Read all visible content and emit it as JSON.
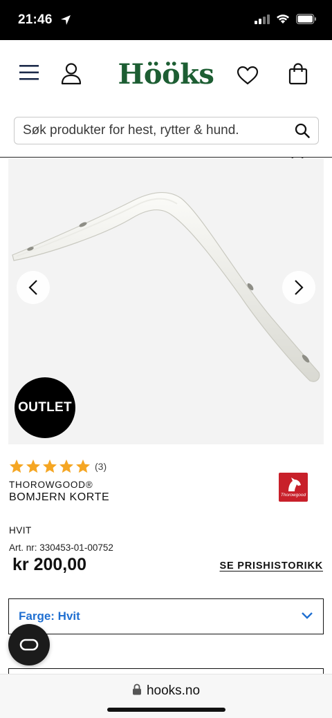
{
  "status_bar": {
    "time": "21:46"
  },
  "header": {
    "logo": "Hööks"
  },
  "search": {
    "placeholder": "Søk produkter for hest, rytter & hund."
  },
  "gallery": {
    "badge": "OUTLET"
  },
  "product": {
    "rating_stars": 5,
    "review_count": "(3)",
    "brand": "THOROWGOOD®",
    "name": "BOMJERN KORTE",
    "brand_logo_text": "Thorowgood",
    "color": "HVIT",
    "article_number": "Art. nr: 330453-01-00752",
    "price": "kr 200,00",
    "price_history_link": "SE PRISHISTORIKK"
  },
  "color_select": {
    "label": "Farge: Hvit"
  },
  "browser": {
    "url": "hooks.no"
  },
  "colors": {
    "brand_green": "#1d5e33",
    "accent_blue": "#1f6fd1",
    "star_orange": "#f5a623",
    "brand_red": "#c8202a"
  }
}
